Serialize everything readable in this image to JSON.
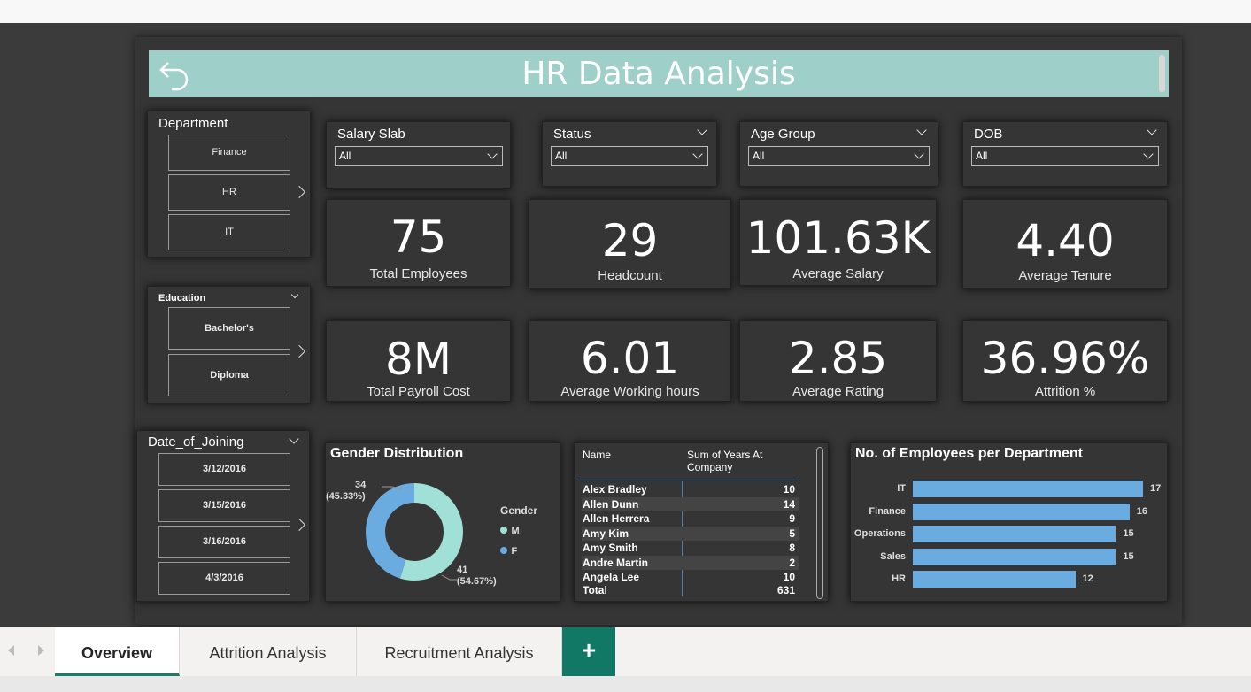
{
  "report": {
    "title": "HR Data Analysis"
  },
  "slicers": {
    "department": {
      "title": "Department",
      "items": [
        "Finance",
        "HR",
        "IT"
      ]
    },
    "education": {
      "title": "Education",
      "items": [
        "Bachelor's",
        "Diploma"
      ]
    },
    "date_of_joining": {
      "title": "Date_of_Joining",
      "items": [
        "3/12/2016",
        "3/15/2016",
        "3/16/2016",
        "4/3/2016"
      ]
    },
    "salary_slab": {
      "title": "Salary Slab",
      "value": "All"
    },
    "status": {
      "title": "Status",
      "value": "All"
    },
    "age_group": {
      "title": "Age Group",
      "value": "All"
    },
    "dob": {
      "title": "DOB",
      "value": "All"
    }
  },
  "kpis": [
    {
      "value": "75",
      "label": "Total Employees"
    },
    {
      "value": "29",
      "label": "Headcount"
    },
    {
      "value": "101.63K",
      "label": "Average Salary"
    },
    {
      "value": "4.40",
      "label": "Average Tenure"
    },
    {
      "value": "8M",
      "label": "Total Payroll Cost"
    },
    {
      "value": "6.01",
      "label": "Average Working hours"
    },
    {
      "value": "2.85",
      "label": "Average Rating"
    },
    {
      "value": "36.96%",
      "label": "Attrition %"
    }
  ],
  "gender_chart": {
    "title": "Gender Distribution",
    "legend_title": "Gender",
    "m_label": "34",
    "m_pct": "(45.33%)",
    "f_label": "41",
    "f_pct": "(54.67%)",
    "legend": [
      "M",
      "F"
    ],
    "colors": {
      "M": "#6aace0",
      "F": "#a1e0d6"
    }
  },
  "years_table": {
    "headers": [
      "Name",
      "Sum of Years At Company"
    ],
    "rows": [
      {
        "name": "Alex Bradley",
        "value": "10"
      },
      {
        "name": "Allen Dunn",
        "value": "14"
      },
      {
        "name": "Allen Herrera",
        "value": "9"
      },
      {
        "name": "Amy Kim",
        "value": "5"
      },
      {
        "name": "Amy Smith",
        "value": "8"
      },
      {
        "name": "Andre Martin",
        "value": "2"
      },
      {
        "name": "Angela Lee",
        "value": "10"
      }
    ],
    "total_label": "Total",
    "total_value": "631"
  },
  "chart_data": {
    "type": "bar",
    "title": "No. of Employees per Department",
    "categories": [
      "IT",
      "Finance",
      "Operations",
      "Sales",
      "HR"
    ],
    "values": [
      17,
      16,
      15,
      15,
      12
    ],
    "orientation": "horizontal",
    "color": "#6aace0"
  },
  "pie_data": {
    "type": "pie",
    "title": "Gender Distribution",
    "categories": [
      "M",
      "F"
    ],
    "values": [
      34,
      41
    ]
  },
  "tabs": [
    "Overview",
    "Attrition Analysis",
    "Recruitment Analysis"
  ],
  "add_tab_label": "+"
}
